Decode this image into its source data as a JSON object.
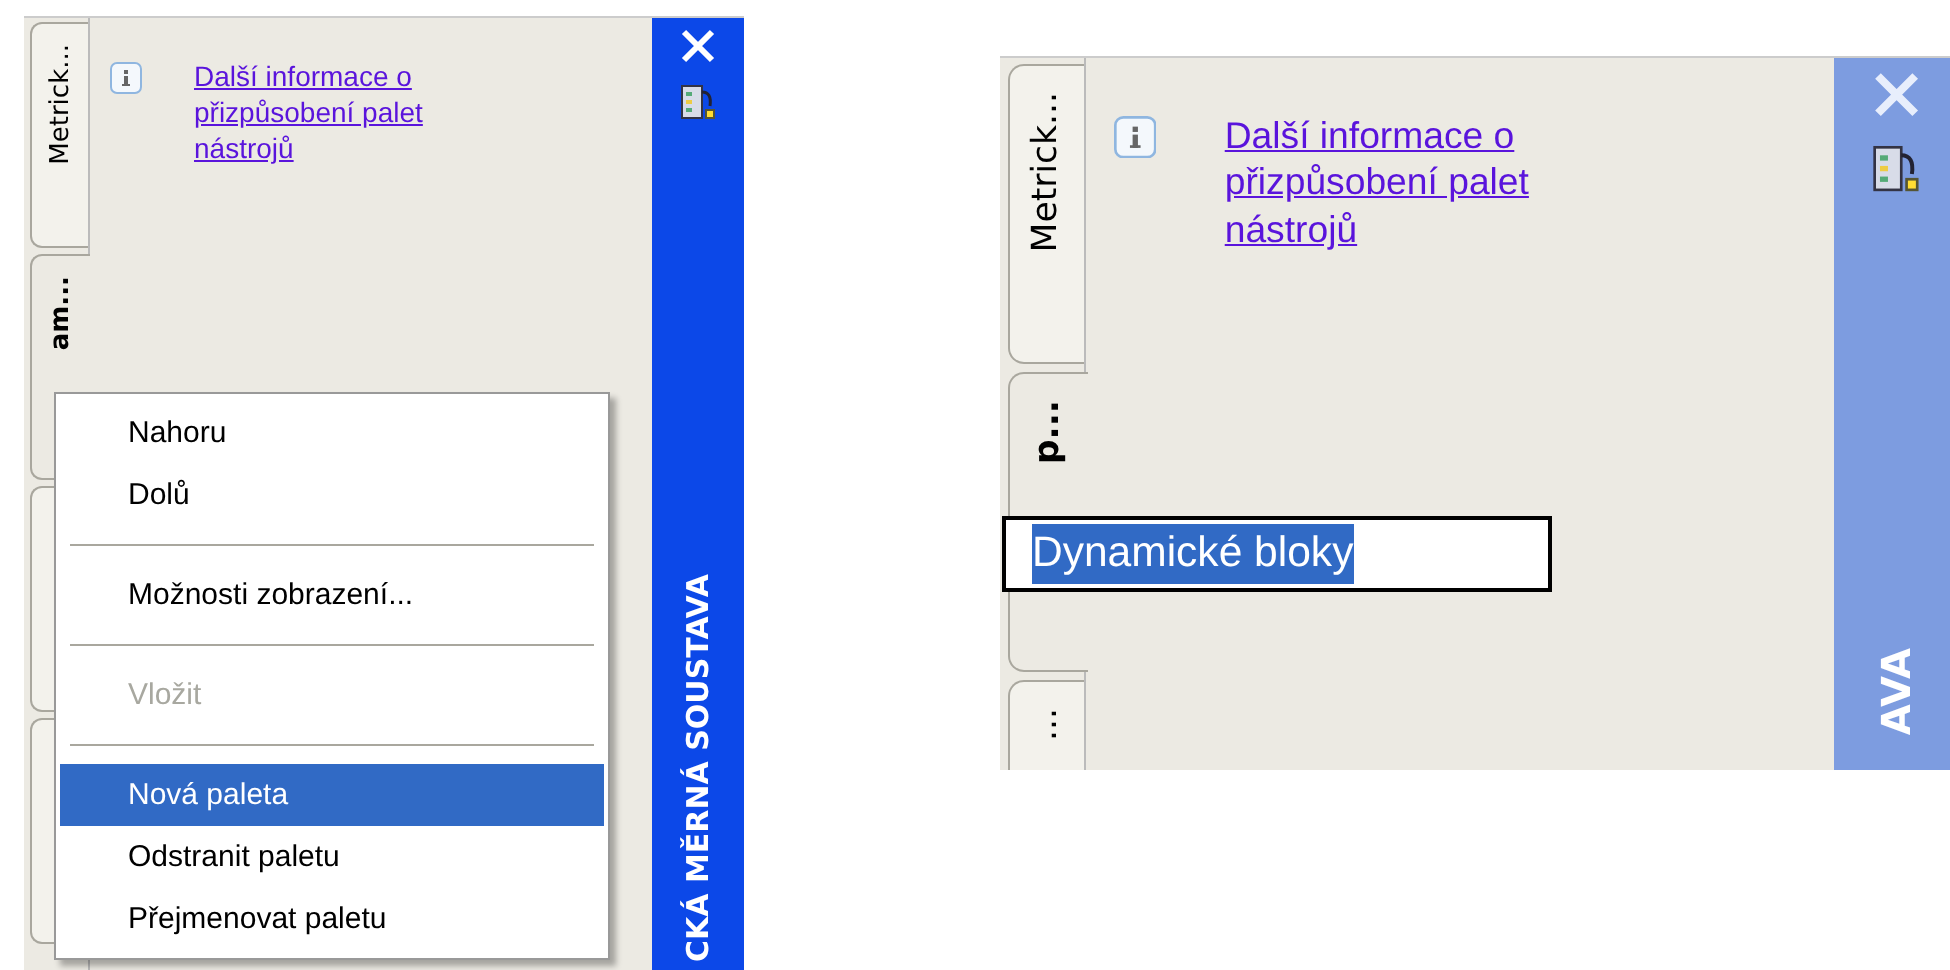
{
  "panels": [
    {
      "active": true,
      "title": "CKÁ MĚRNÁ SOUSTAVA",
      "info_link": "Další informace o přizpůsobení palet nástrojů",
      "tabs": [
        {
          "label": "Metrick...",
          "selected": false
        },
        {
          "label": "am...",
          "selected": true
        },
        {
          "selected": false
        },
        {
          "selected": false
        }
      ],
      "context_menu": {
        "items": [
          {
            "kind": "item",
            "label": "Nahoru",
            "disabled": false,
            "selected": false
          },
          {
            "kind": "item",
            "label": "Dolů",
            "disabled": false,
            "selected": false
          },
          {
            "kind": "separator"
          },
          {
            "kind": "item",
            "label": "Možnosti zobrazení...",
            "disabled": false,
            "selected": false
          },
          {
            "kind": "separator"
          },
          {
            "kind": "item",
            "label": "Vložit",
            "disabled": true,
            "selected": false
          },
          {
            "kind": "separator"
          },
          {
            "kind": "item",
            "label": "Nová paleta",
            "disabled": false,
            "selected": true
          },
          {
            "kind": "item",
            "label": "Odstranit paletu",
            "disabled": false,
            "selected": false
          },
          {
            "kind": "item",
            "label": "Přejmenovat paletu",
            "disabled": false,
            "selected": false
          }
        ]
      }
    },
    {
      "active": false,
      "title": "AVA",
      "info_link": "Další informace o přizpůsobení palet nástrojů",
      "tabs": [
        {
          "label": "Metrick...",
          "selected": false
        },
        {
          "label": "p...",
          "selected": true
        },
        {
          "label": "...",
          "selected": false
        }
      ],
      "rename_field": {
        "value": "Dynamické bloky"
      }
    }
  ]
}
